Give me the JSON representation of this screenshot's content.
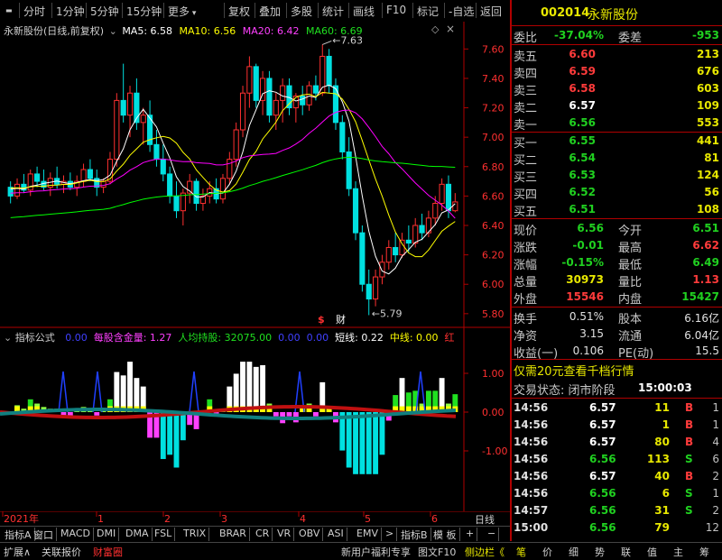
{
  "toolbar": {
    "items": [
      "分时",
      "1分钟",
      "5分钟",
      "15分钟",
      "更多",
      "复权",
      "叠加",
      "多股",
      "统计",
      "画线",
      "F10",
      "标记",
      "-自选",
      "返回"
    ]
  },
  "chart": {
    "stock_title": "永新股份(日线,前复权)",
    "ma5_label": "MA5: 6.58",
    "ma10_label": "MA10: 6.56",
    "ma20_label": "MA20: 6.42",
    "ma60_label": "MA60: 6.69",
    "price_ticks": [
      "7.60",
      "7.40",
      "7.20",
      "7.00",
      "6.80",
      "6.60",
      "6.40",
      "6.20",
      "6.00",
      "5.80"
    ],
    "high_annotation": "7.63",
    "low_annotation": "5.79",
    "marker_dollar": "$",
    "marker_cai": "财",
    "colors": {
      "up": "#ff3030",
      "down": "#00e0e0",
      "ma5": "#ffffff",
      "ma10": "#ffff00",
      "ma20": "#ff00ff",
      "ma60": "#00ff00"
    }
  },
  "chart_data": {
    "type": "candlestick",
    "ylim": [
      5.75,
      7.7
    ],
    "x_month_labels": [
      "2021年",
      "1",
      "2",
      "3",
      "4",
      "5",
      "6"
    ],
    "candles": [
      [
        6.66,
        6.7,
        6.55,
        6.6
      ],
      [
        6.6,
        6.72,
        6.58,
        6.68
      ],
      [
        6.68,
        6.75,
        6.62,
        6.64
      ],
      [
        6.64,
        6.78,
        6.6,
        6.75
      ],
      [
        6.75,
        6.8,
        6.66,
        6.7
      ],
      [
        6.7,
        6.78,
        6.64,
        6.66
      ],
      [
        6.66,
        6.76,
        6.6,
        6.72
      ],
      [
        6.72,
        6.8,
        6.65,
        6.68
      ],
      [
        6.68,
        6.74,
        6.62,
        6.7
      ],
      [
        6.7,
        6.76,
        6.64,
        6.66
      ],
      [
        6.66,
        6.74,
        6.6,
        6.7
      ],
      [
        6.7,
        6.82,
        6.66,
        6.78
      ],
      [
        6.78,
        6.85,
        6.7,
        6.72
      ],
      [
        6.72,
        6.78,
        6.6,
        6.66
      ],
      [
        6.66,
        6.72,
        6.62,
        6.7
      ],
      [
        6.7,
        6.9,
        6.68,
        6.85
      ],
      [
        6.85,
        7.3,
        6.8,
        7.25
      ],
      [
        7.25,
        7.5,
        7.1,
        7.15
      ],
      [
        7.15,
        7.35,
        7.0,
        7.3
      ],
      [
        7.3,
        7.4,
        7.05,
        7.1
      ],
      [
        7.1,
        7.2,
        6.95,
        7.15
      ],
      [
        7.15,
        7.25,
        6.9,
        6.95
      ],
      [
        6.95,
        7.05,
        6.8,
        6.85
      ],
      [
        6.85,
        6.95,
        6.7,
        6.75
      ],
      [
        6.75,
        6.8,
        6.55,
        6.6
      ],
      [
        6.6,
        6.7,
        6.45,
        6.5
      ],
      [
        6.5,
        6.65,
        6.4,
        6.62
      ],
      [
        6.62,
        6.75,
        6.55,
        6.7
      ],
      [
        6.7,
        6.72,
        6.5,
        6.55
      ],
      [
        6.55,
        6.65,
        6.5,
        6.6
      ],
      [
        6.6,
        6.7,
        6.55,
        6.65
      ],
      [
        6.65,
        6.72,
        6.55,
        6.58
      ],
      [
        6.58,
        6.75,
        6.55,
        6.72
      ],
      [
        6.72,
        6.9,
        6.68,
        6.85
      ],
      [
        6.85,
        7.1,
        6.8,
        7.05
      ],
      [
        7.05,
        7.35,
        7.0,
        7.3
      ],
      [
        7.3,
        7.55,
        7.2,
        7.48
      ],
      [
        7.48,
        7.5,
        7.2,
        7.25
      ],
      [
        7.25,
        7.45,
        7.15,
        7.4
      ],
      [
        7.4,
        7.45,
        7.1,
        7.15
      ],
      [
        7.15,
        7.3,
        7.05,
        7.25
      ],
      [
        7.25,
        7.4,
        7.1,
        7.35
      ],
      [
        7.35,
        7.4,
        7.15,
        7.2
      ],
      [
        7.2,
        7.3,
        7.1,
        7.28
      ],
      [
        7.28,
        7.35,
        7.15,
        7.22
      ],
      [
        7.22,
        7.38,
        7.18,
        7.35
      ],
      [
        7.35,
        7.42,
        7.25,
        7.3
      ],
      [
        7.3,
        7.63,
        7.28,
        7.55
      ],
      [
        7.55,
        7.6,
        7.3,
        7.35
      ],
      [
        7.35,
        7.4,
        7.05,
        7.1
      ],
      [
        7.1,
        7.15,
        6.85,
        6.9
      ],
      [
        6.9,
        7.0,
        6.6,
        6.65
      ],
      [
        6.65,
        6.7,
        6.3,
        6.35
      ],
      [
        6.35,
        6.4,
        5.95,
        6.0
      ],
      [
        6.0,
        6.1,
        5.79,
        5.9
      ],
      [
        5.9,
        6.1,
        5.85,
        6.05
      ],
      [
        6.05,
        6.2,
        6.0,
        6.15
      ],
      [
        6.15,
        6.3,
        6.1,
        6.25
      ],
      [
        6.25,
        6.35,
        6.15,
        6.2
      ],
      [
        6.2,
        6.35,
        6.18,
        6.3
      ],
      [
        6.3,
        6.4,
        6.22,
        6.28
      ],
      [
        6.28,
        6.45,
        6.25,
        6.4
      ],
      [
        6.4,
        6.48,
        6.3,
        6.35
      ],
      [
        6.35,
        6.5,
        6.32,
        6.45
      ],
      [
        6.45,
        6.6,
        6.4,
        6.55
      ],
      [
        6.55,
        6.72,
        6.5,
        6.68
      ],
      [
        6.68,
        6.74,
        6.45,
        6.5
      ],
      [
        6.5,
        6.62,
        6.49,
        6.56
      ]
    ],
    "ma_last": {
      "MA5": 6.58,
      "MA10": 6.56,
      "MA20": 6.42,
      "MA60": 6.69
    }
  },
  "indicator": {
    "title": "指标公式",
    "items": [
      {
        "text": "0.00",
        "color": "#4040ff"
      },
      {
        "text": "每股含金量: 1.27",
        "color": "#ff40ff"
      },
      {
        "text": "人均持股: 32075.00",
        "color": "#20e020"
      },
      {
        "text": "0.00",
        "color": "#4040ff"
      },
      {
        "text": "0.00",
        "color": "#4040ff"
      },
      {
        "text": "短线: 0.22",
        "color": "#ffffff"
      },
      {
        "text": "中线: 0.00",
        "color": "#ffff00"
      },
      {
        "text": "红",
        "color": "#ff3030"
      }
    ],
    "ticks": [
      "1.00",
      "0.00",
      "-1.00"
    ]
  },
  "x_axis": {
    "label_right": "日线",
    "months": [
      "2021年",
      "1",
      "2",
      "3",
      "4",
      "5",
      "6"
    ]
  },
  "tabbar": {
    "tabs": [
      "指标A",
      "窗口",
      "MACD",
      "DMI",
      "DMA",
      "FSL",
      "TRIX",
      "BRAR",
      "CR",
      "VR",
      "OBV",
      "ASI",
      "EMV",
      ">"
    ],
    "right": [
      "指标B",
      "模 板",
      "+",
      "−"
    ]
  },
  "statusbar": {
    "items": [
      "扩展∧",
      "关联报价",
      "财富圈"
    ],
    "news": "新用户福利专享",
    "right_items": [
      "图文F10",
      "侧边栏《"
    ],
    "panel_tabs": [
      "笔",
      "价",
      "细",
      "势",
      "联",
      "值",
      "主",
      "筹"
    ]
  },
  "quote": {
    "code": "002014",
    "name": "永新股份",
    "weibi_label": "委比",
    "weibi": "-37.04%",
    "weicha_label": "委差",
    "weicha": "-953",
    "asks": [
      {
        "label": "卖五",
        "price": "6.60",
        "vol": "213",
        "pc": "red"
      },
      {
        "label": "卖四",
        "price": "6.59",
        "vol": "676",
        "pc": "red"
      },
      {
        "label": "卖三",
        "price": "6.58",
        "vol": "603",
        "pc": "red"
      },
      {
        "label": "卖二",
        "price": "6.57",
        "vol": "109",
        "pc": "white"
      },
      {
        "label": "卖一",
        "price": "6.56",
        "vol": "553",
        "pc": "green"
      }
    ],
    "bids": [
      {
        "label": "买一",
        "price": "6.55",
        "vol": "441",
        "pc": "green"
      },
      {
        "label": "买二",
        "price": "6.54",
        "vol": "81",
        "pc": "green"
      },
      {
        "label": "买三",
        "price": "6.53",
        "vol": "124",
        "pc": "green"
      },
      {
        "label": "买四",
        "price": "6.52",
        "vol": "56",
        "pc": "green"
      },
      {
        "label": "买五",
        "price": "6.51",
        "vol": "108",
        "pc": "green"
      }
    ],
    "stats": [
      {
        "l1": "现价",
        "v1": "6.56",
        "c1": "green",
        "l2": "今开",
        "v2": "6.51",
        "c2": "green"
      },
      {
        "l1": "涨跌",
        "v1": "-0.01",
        "c1": "green",
        "l2": "最高",
        "v2": "6.62",
        "c2": "red"
      },
      {
        "l1": "涨幅",
        "v1": "-0.15%",
        "c1": "green",
        "l2": "最低",
        "v2": "6.49",
        "c2": "green"
      },
      {
        "l1": "总量",
        "v1": "30973",
        "c1": "yellow",
        "l2": "量比",
        "v2": "1.13",
        "c2": "red"
      },
      {
        "l1": "外盘",
        "v1": "15546",
        "c1": "red",
        "l2": "内盘",
        "v2": "15427",
        "c2": "green"
      }
    ],
    "stats2": [
      {
        "l1": "换手",
        "v1": "0.51%",
        "c1": "gray",
        "l2": "股本",
        "v2": "6.16亿",
        "c2": "gray"
      },
      {
        "l1": "净资",
        "v1": "3.15",
        "c1": "gray",
        "l2": "流通",
        "v2": "6.04亿",
        "c2": "gray"
      },
      {
        "l1": "收益(一)",
        "v1": "0.106",
        "c1": "gray",
        "l2": "PE(动)",
        "v2": "15.5",
        "c2": "gray"
      }
    ],
    "promo": "仅需20元查看千档行情",
    "trade_status_label": "交易状态: 闭市阶段",
    "trade_time": "15:00:03",
    "ticks": [
      {
        "t": "14:56",
        "p": "6.57",
        "pc": "white",
        "v": "11",
        "bs": "B",
        "bc": "red",
        "n": "1"
      },
      {
        "t": "14:56",
        "p": "6.57",
        "pc": "white",
        "v": "1",
        "bs": "B",
        "bc": "red",
        "n": "1"
      },
      {
        "t": "14:56",
        "p": "6.57",
        "pc": "white",
        "v": "80",
        "bs": "B",
        "bc": "red",
        "n": "4"
      },
      {
        "t": "14:56",
        "p": "6.56",
        "pc": "green",
        "v": "113",
        "bs": "S",
        "bc": "green",
        "n": "6"
      },
      {
        "t": "14:56",
        "p": "6.57",
        "pc": "white",
        "v": "40",
        "bs": "B",
        "bc": "red",
        "n": "2"
      },
      {
        "t": "14:56",
        "p": "6.56",
        "pc": "green",
        "v": "6",
        "bs": "S",
        "bc": "green",
        "n": "1"
      },
      {
        "t": "14:57",
        "p": "6.56",
        "pc": "green",
        "v": "31",
        "bs": "S",
        "bc": "green",
        "n": "2"
      },
      {
        "t": "15:00",
        "p": "6.56",
        "pc": "green",
        "v": "79",
        "bs": "",
        "bc": "gray",
        "n": "12"
      }
    ]
  }
}
